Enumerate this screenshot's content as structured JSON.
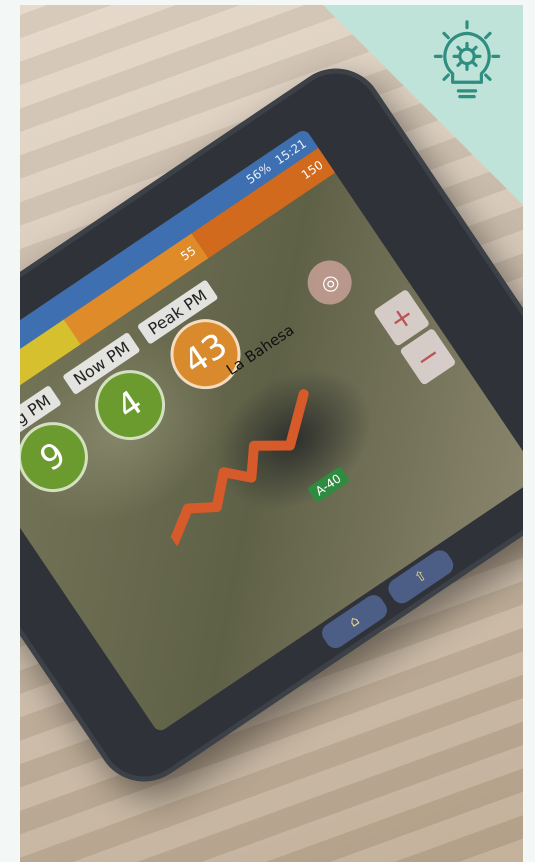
{
  "screen": {
    "status_bar": {
      "battery_percent": "56%",
      "time": "15:21"
    },
    "pm_bar": {
      "segments": [
        "55",
        "150"
      ]
    },
    "metrics": [
      {
        "label": "Avg PM",
        "value": "9",
        "color": "#6b9b2e"
      },
      {
        "label": "Now PM",
        "value": "4",
        "color": "#6b9b2e"
      },
      {
        "label": "Peak PM",
        "value": "43",
        "color": "#d98a2c"
      }
    ],
    "map": {
      "place_label": "La Bahesa",
      "road_label": "A-40",
      "zoom_in": "+",
      "zoom_out": "−",
      "locate_icon": "target-icon"
    },
    "nav_keys": [
      "⌂",
      "⇧"
    ]
  },
  "corner_badge": {
    "icon": "lightbulb-gear-icon",
    "color": "#bfe3d9"
  }
}
